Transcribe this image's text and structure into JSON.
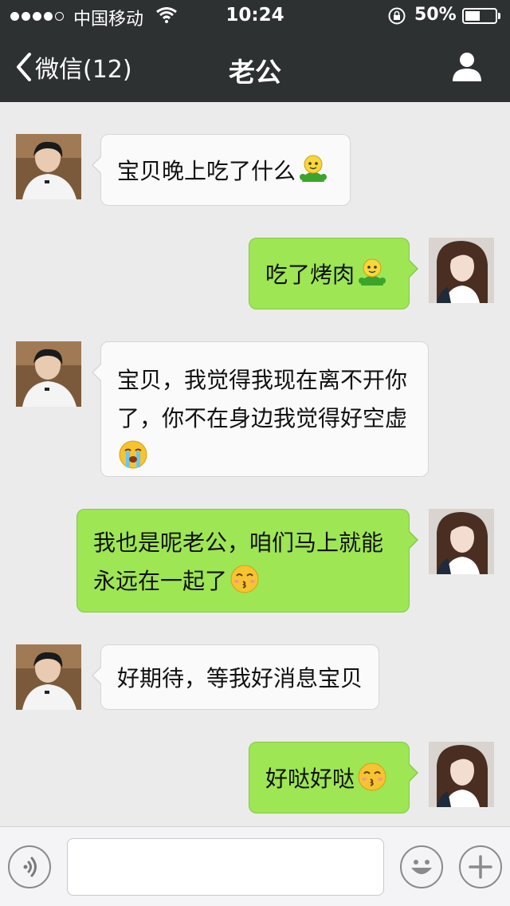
{
  "status_bar": {
    "carrier": "中国移动",
    "time": "10:24",
    "battery_percent_label": "50%",
    "battery_level": 0.5
  },
  "nav": {
    "back_label": "微信(12)",
    "title": "老公"
  },
  "messages": [
    {
      "side": "in",
      "sender": "husband",
      "text": "宝贝晚上吃了什么",
      "emoji": "green-doll-emoji"
    },
    {
      "side": "out",
      "sender": "me",
      "text": "吃了烤肉",
      "emoji": "green-doll-emoji"
    },
    {
      "side": "in",
      "sender": "husband",
      "text_lines": [
        "宝贝，我觉得我现在离不开你",
        "了，你不在身边我觉得好空虚"
      ],
      "emoji": "crying-face-emoji"
    },
    {
      "side": "out",
      "sender": "me",
      "text_lines": [
        "我也是呢老公，咱们马上就能",
        "永远在一起了"
      ],
      "emoji": "kissing-face-emoji"
    },
    {
      "side": "in",
      "sender": "husband",
      "text": "好期待，等我好消息宝贝"
    },
    {
      "side": "out",
      "sender": "me",
      "text": "好哒好哒",
      "emoji": "kissing-face-emoji"
    }
  ],
  "input": {
    "value": "",
    "placeholder": ""
  },
  "colors": {
    "header_bg": "#2e3132",
    "chat_bg": "#ebebeb",
    "incoming_bubble": "#fafafa",
    "outgoing_bubble": "#9ee654"
  }
}
